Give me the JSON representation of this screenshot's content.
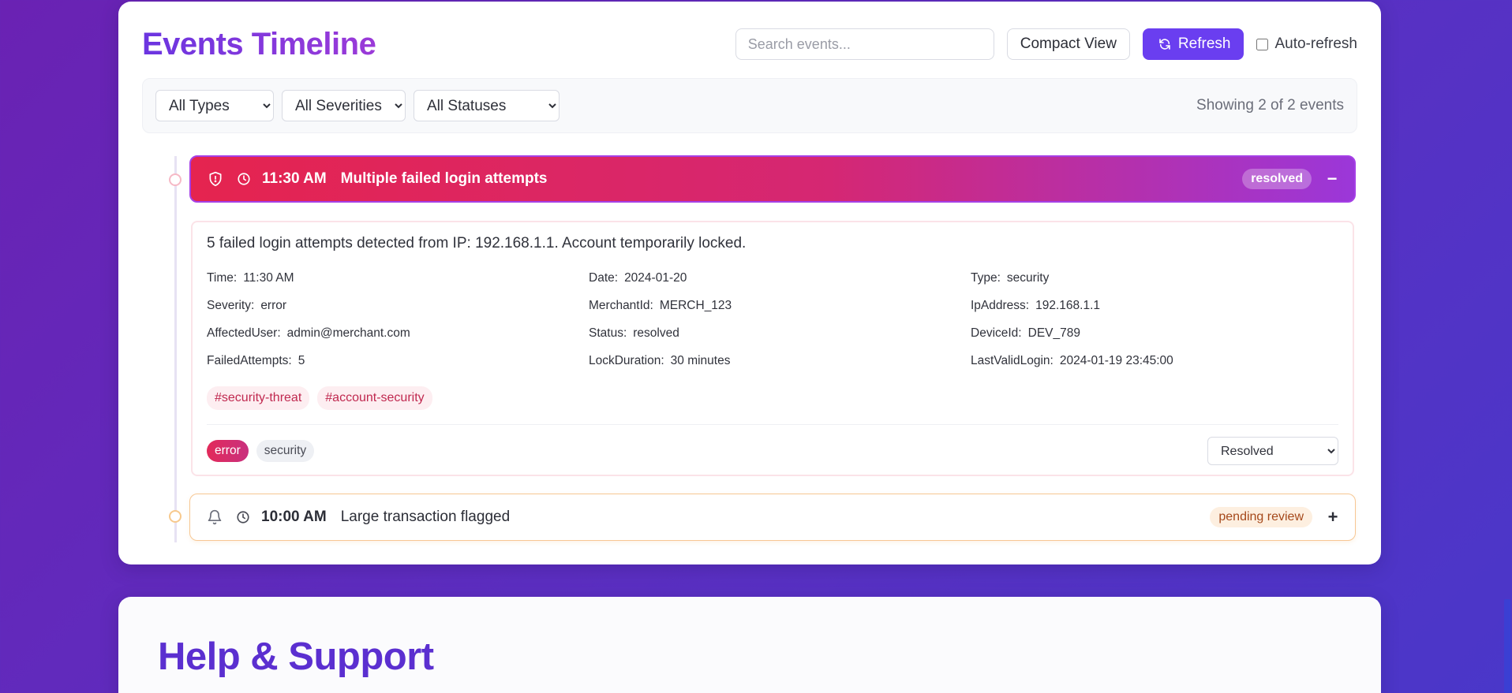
{
  "events_panel": {
    "title": "Events Timeline",
    "search_placeholder": "Search events...",
    "compact_view_label": "Compact View",
    "refresh_label": "Refresh",
    "auto_refresh_label": "Auto-refresh",
    "auto_refresh_checked": false,
    "filters": {
      "type_selected": "All Types",
      "severity_selected": "All Severities",
      "status_selected": "All Statuses",
      "count_text": "Showing 2 of 2 events"
    },
    "events": [
      {
        "icon": "shield-icon",
        "time": "11:30 AM",
        "title": "Multiple failed login attempts",
        "status": "resolved",
        "toggle": "−",
        "description": "5 failed login attempts detected from IP: 192.168.1.1. Account temporarily locked.",
        "meta": [
          {
            "key": "Time:",
            "value": "11:30 AM"
          },
          {
            "key": "Date:",
            "value": "2024-01-20"
          },
          {
            "key": "Type:",
            "value": "security"
          },
          {
            "key": "Severity:",
            "value": "error"
          },
          {
            "key": "MerchantId:",
            "value": "MERCH_123"
          },
          {
            "key": "IpAddress:",
            "value": "192.168.1.1"
          },
          {
            "key": "AffectedUser:",
            "value": "admin@merchant.com"
          },
          {
            "key": "Status:",
            "value": "resolved"
          },
          {
            "key": "DeviceId:",
            "value": "DEV_789"
          },
          {
            "key": "FailedAttempts:",
            "value": "5"
          },
          {
            "key": "LockDuration:",
            "value": "30 minutes"
          },
          {
            "key": "LastValidLogin:",
            "value": "2024-01-19 23:45:00"
          }
        ],
        "tags": [
          "#security-threat",
          "#account-security"
        ],
        "severity_badge": "error",
        "type_badge": "security",
        "status_select_value": "Resolved"
      },
      {
        "icon": "bell-icon",
        "time": "10:00 AM",
        "title": "Large transaction flagged",
        "status": "pending review",
        "toggle": "+"
      }
    ]
  },
  "help_panel": {
    "title": "Help & Support"
  },
  "colors": {
    "background_start": "#6a22b3",
    "background_end": "#4a37c9",
    "primary": "#6a3ef0",
    "error_gradient_start": "#e5244f",
    "error_gradient_end": "#9b37d9",
    "pending": "#a5481a"
  }
}
